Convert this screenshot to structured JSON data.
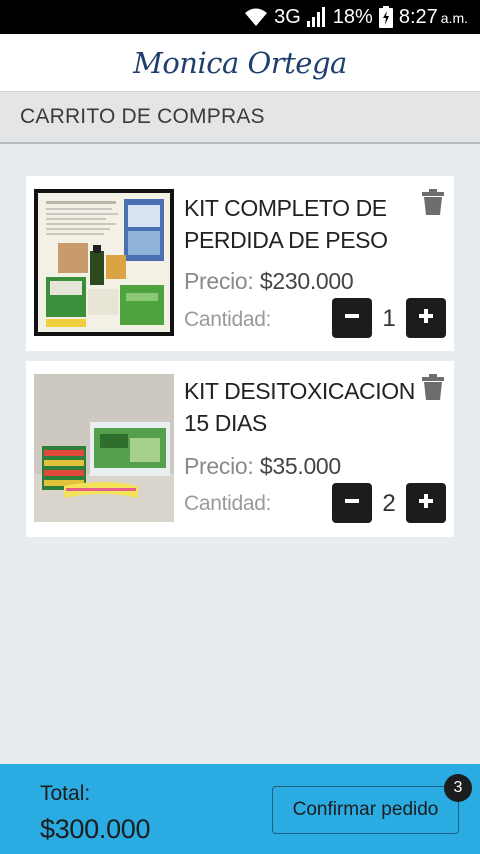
{
  "status_bar": {
    "network": "3G",
    "battery": "18%",
    "time": "8:27",
    "ampm": "a.m."
  },
  "header": {
    "brand": "Monica Ortega"
  },
  "page": {
    "title": "CARRITO DE COMPRAS"
  },
  "cart": {
    "items": [
      {
        "name_line1": "KIT COMPLETO DE",
        "name_line2": "PERDIDA DE PESO",
        "price_label": "Precio:",
        "price": "$230.000",
        "qty_label": "Cantidad:",
        "quantity": "1"
      },
      {
        "name_line1": "KIT DESITOXICACION",
        "name_line2": "15 DIAS",
        "price_label": "Precio:",
        "price": "$35.000",
        "qty_label": "Cantidad:",
        "quantity": "2"
      }
    ]
  },
  "footer": {
    "total_label": "Total:",
    "total_value": "$300.000",
    "confirm_label": "Confirmar pedido",
    "badge_count": "3"
  },
  "colors": {
    "footer_bg": "#2aabe2",
    "brand_text": "#1f3f6e",
    "qty_button": "#1c1c1c"
  },
  "icons": [
    "wifi-icon",
    "signal-icon",
    "battery-icon",
    "trash-icon",
    "minus-icon",
    "plus-icon"
  ]
}
